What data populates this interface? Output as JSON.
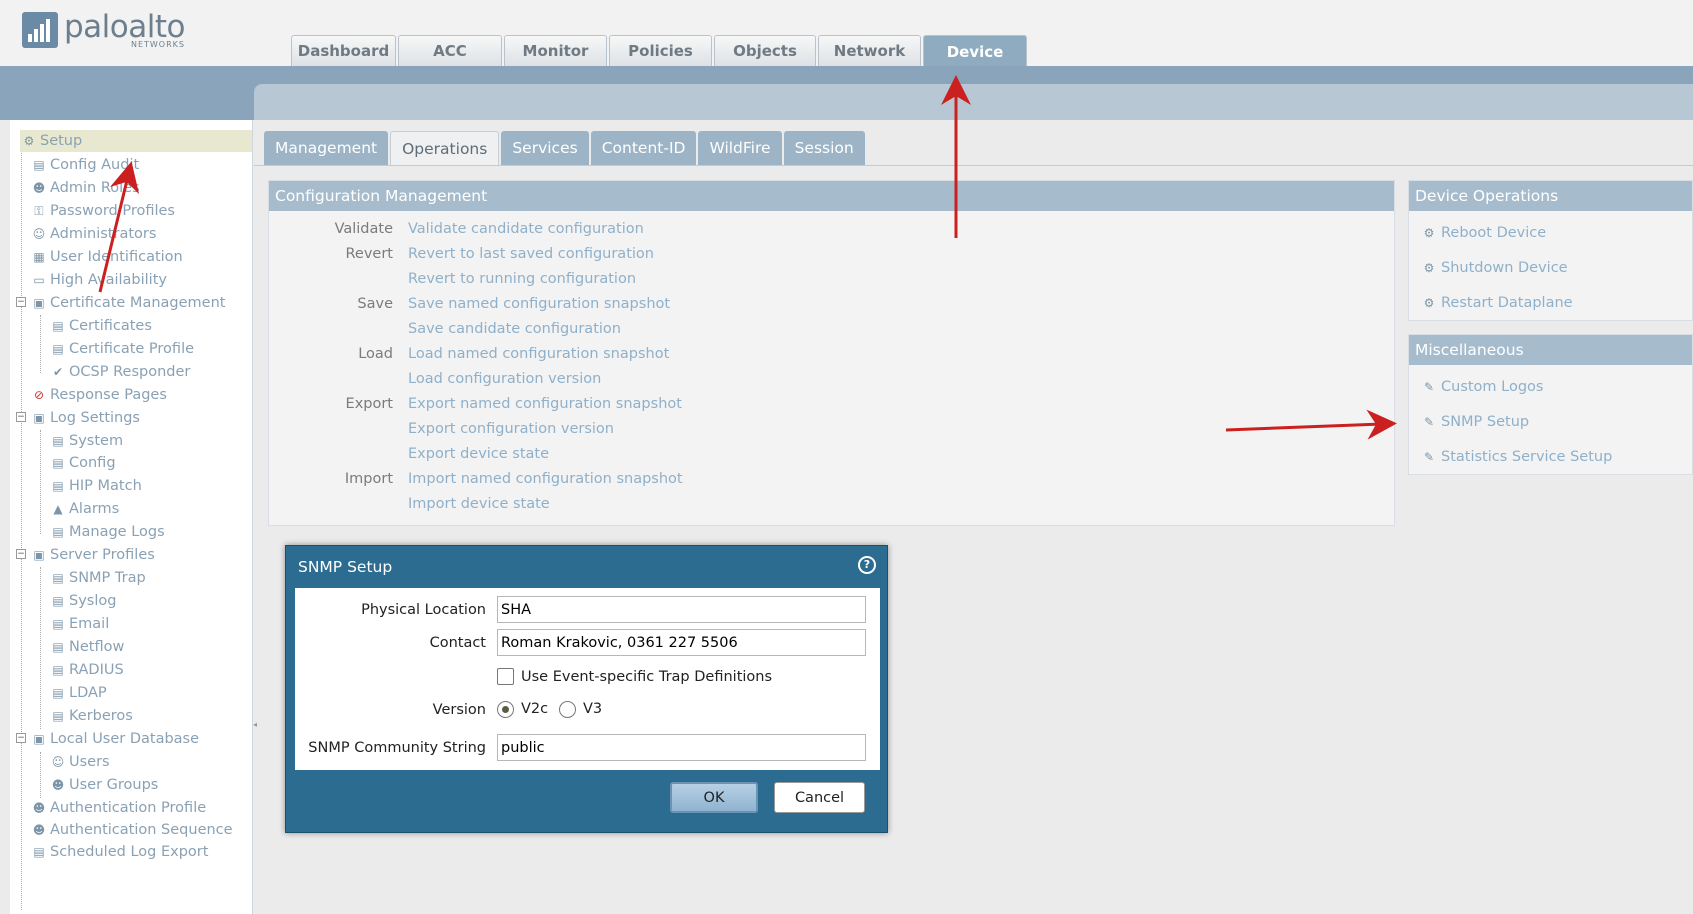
{
  "header": {
    "logo_text": "paloalto",
    "logo_sub": "NETWORKS",
    "tabs": [
      "Dashboard",
      "ACC",
      "Monitor",
      "Policies",
      "Objects",
      "Network",
      "Device"
    ],
    "active_tab": "Device"
  },
  "sidebar": {
    "items": [
      {
        "label": "Setup",
        "icon": "setup-icon"
      },
      {
        "label": "Config Audit",
        "icon": "config-audit-icon"
      },
      {
        "label": "Admin Roles",
        "icon": "admin-roles-icon"
      },
      {
        "label": "Password Profiles",
        "icon": "password-profiles-icon"
      },
      {
        "label": "Administrators",
        "icon": "administrators-icon"
      },
      {
        "label": "User Identification",
        "icon": "user-identification-icon"
      },
      {
        "label": "High Availability",
        "icon": "high-availability-icon"
      },
      {
        "label": "Certificate Management",
        "icon": "certificate-management-icon"
      },
      {
        "label": "Certificates",
        "icon": "certificates-icon"
      },
      {
        "label": "Certificate Profile",
        "icon": "certificate-profile-icon"
      },
      {
        "label": "OCSP Responder",
        "icon": "ocsp-responder-icon"
      },
      {
        "label": "Response Pages",
        "icon": "response-pages-icon"
      },
      {
        "label": "Log Settings",
        "icon": "log-settings-icon"
      },
      {
        "label": "System",
        "icon": "system-log-icon"
      },
      {
        "label": "Config",
        "icon": "config-log-icon"
      },
      {
        "label": "HIP Match",
        "icon": "hip-match-icon"
      },
      {
        "label": "Alarms",
        "icon": "alarms-icon"
      },
      {
        "label": "Manage Logs",
        "icon": "manage-logs-icon"
      },
      {
        "label": "Server Profiles",
        "icon": "server-profiles-icon"
      },
      {
        "label": "SNMP Trap",
        "icon": "snmp-trap-icon"
      },
      {
        "label": "Syslog",
        "icon": "syslog-icon"
      },
      {
        "label": "Email",
        "icon": "email-icon"
      },
      {
        "label": "Netflow",
        "icon": "netflow-icon"
      },
      {
        "label": "RADIUS",
        "icon": "radius-icon"
      },
      {
        "label": "LDAP",
        "icon": "ldap-icon"
      },
      {
        "label": "Kerberos",
        "icon": "kerberos-icon"
      },
      {
        "label": "Local User Database",
        "icon": "local-user-database-icon"
      },
      {
        "label": "Users",
        "icon": "users-icon"
      },
      {
        "label": "User Groups",
        "icon": "user-groups-icon"
      },
      {
        "label": "Authentication Profile",
        "icon": "authentication-profile-icon"
      },
      {
        "label": "Authentication Sequence",
        "icon": "authentication-sequence-icon"
      },
      {
        "label": "Scheduled Log Export",
        "icon": "scheduled-log-export-icon"
      }
    ]
  },
  "sub_tabs": {
    "items": [
      "Management",
      "Operations",
      "Services",
      "Content-ID",
      "WildFire",
      "Session"
    ],
    "active": "Operations"
  },
  "config_mgmt": {
    "title": "Configuration Management",
    "rows": [
      {
        "label": "Validate",
        "link": "Validate candidate configuration"
      },
      {
        "label": "Revert",
        "link": "Revert to last saved configuration"
      },
      {
        "label": "",
        "link": "Revert to running configuration"
      },
      {
        "label": "Save",
        "link": "Save named configuration snapshot"
      },
      {
        "label": "",
        "link": "Save candidate configuration"
      },
      {
        "label": "Load",
        "link": "Load named configuration snapshot"
      },
      {
        "label": "",
        "link": "Load configuration version"
      },
      {
        "label": "Export",
        "link": "Export named configuration snapshot"
      },
      {
        "label": "",
        "link": "Export configuration version"
      },
      {
        "label": "",
        "link": "Export device state"
      },
      {
        "label": "Import",
        "link": "Import named configuration snapshot"
      },
      {
        "label": "",
        "link": "Import device state"
      }
    ]
  },
  "device_ops": {
    "title": "Device Operations",
    "items": [
      "Reboot Device",
      "Shutdown Device",
      "Restart Dataplane"
    ]
  },
  "misc": {
    "title": "Miscellaneous",
    "items": [
      "Custom Logos",
      "SNMP Setup",
      "Statistics Service Setup"
    ]
  },
  "dialog": {
    "title": "SNMP Setup",
    "help": "?",
    "physical_location_label": "Physical Location",
    "physical_location_value": "SHA",
    "contact_label": "Contact",
    "contact_value": "Roman Krakovic, 0361 227 5506",
    "trap_label": "Use Event-specific Trap Definitions",
    "trap_checked": false,
    "version_label": "Version",
    "version_options": [
      "V2c",
      "V3"
    ],
    "version_selected": "V2c",
    "community_label": "SNMP Community String",
    "community_value": "public",
    "ok_label": "OK",
    "cancel_label": "Cancel"
  },
  "colors": {
    "accent": "#8aa5bb",
    "link": "#8fb0ca",
    "dialog": "#2c6c90",
    "annotation_arrow": "#cc1f1f"
  }
}
